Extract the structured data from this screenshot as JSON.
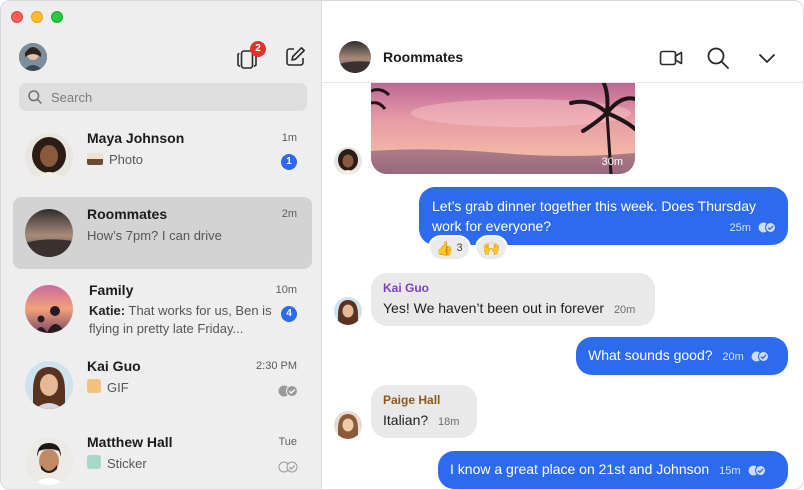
{
  "sidebar": {
    "story_badge": "2",
    "search_placeholder": "Search",
    "chats": [
      {
        "name": "Maya Johnson",
        "time": "1m",
        "preview": "Photo",
        "unread": "1"
      },
      {
        "name": "Roommates",
        "time": "2m",
        "preview": "How’s 7pm? I can drive"
      },
      {
        "name": "Family",
        "time": "10m",
        "sender": "Katie:",
        "preview": "That works for us, Ben is flying in pretty late Friday...",
        "unread": "4"
      },
      {
        "name": "Kai Guo",
        "time": "2:30 PM",
        "preview": "GIF"
      },
      {
        "name": "Matthew Hall",
        "time": "Tue",
        "preview": "Sticker"
      }
    ]
  },
  "conversation": {
    "title": "Roommates",
    "photo_time": "30m",
    "messages": [
      {
        "direction": "out",
        "text": "Let’s grab dinner together this week. Does Thursday work for everyone?",
        "time": "25m"
      },
      {
        "direction": "in",
        "sender": "Kai Guo",
        "text": "Yes! We haven’t been out in forever",
        "time": "20m"
      },
      {
        "direction": "out",
        "text": "What sounds good?",
        "time": "20m"
      },
      {
        "direction": "in",
        "sender": "Paige Hall",
        "text": "Italian?",
        "time": "18m"
      },
      {
        "direction": "out",
        "text": "I know a great place on 21st and Johnson",
        "time": "15m"
      }
    ],
    "reactions": [
      {
        "emoji": "👍",
        "count": "3"
      },
      {
        "emoji": "🙌",
        "count": ""
      }
    ]
  },
  "colors": {
    "accent": "#2c6bed",
    "badge_red": "#e5322d",
    "sidebar_bg": "#eeeeee",
    "kai_name": "#7d3cc9",
    "paige_name": "#8a5a1a"
  }
}
